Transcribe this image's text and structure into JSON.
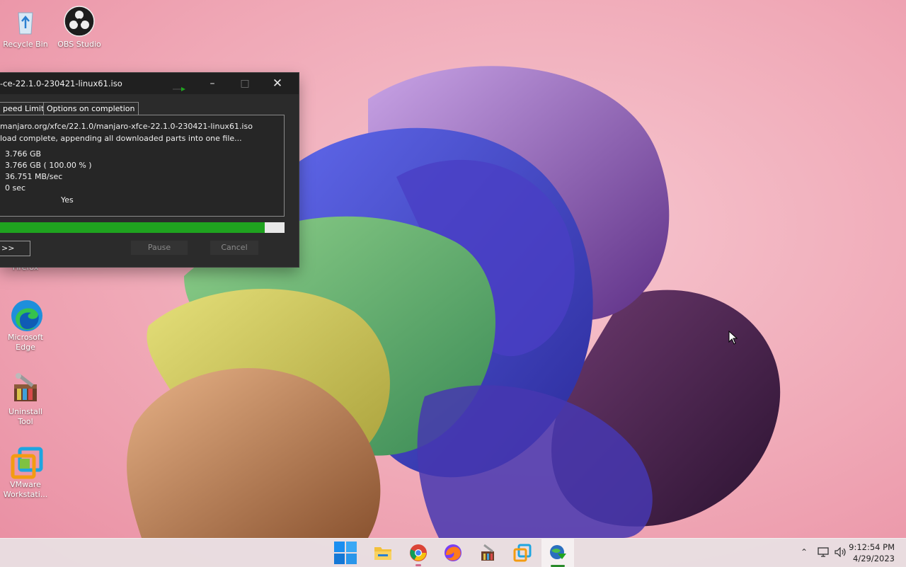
{
  "desktop": {
    "icons": [
      {
        "label": "Recycle Bin",
        "icon": "recycle-bin-icon"
      },
      {
        "label": "OBS Studio",
        "icon": "obs-studio-icon"
      },
      {
        "label": "Firefox",
        "icon": "firefox-icon"
      },
      {
        "label": "Microsoft Edge",
        "icon": "edge-icon"
      },
      {
        "label": "Uninstall Tool",
        "icon": "uninstall-tool-icon"
      },
      {
        "label": "VMware Workstati...",
        "icon": "vmware-icon"
      }
    ]
  },
  "idm_window": {
    "title": "-ce-22.1.0-230421-linux61.iso",
    "tabs": [
      "peed Limiter",
      "Options on completion"
    ],
    "url_line": "manjaro.org/xfce/22.1.0/manjaro-xfce-22.1.0-230421-linux61.iso",
    "status_line": "load complete, appending all downloaded parts into one file...",
    "file_size": "3.766  GB",
    "downloaded": "3.766  GB  ( 100.00 % )",
    "transfer_rate": "36.751  MB/sec",
    "time_left": "0 sec",
    "resume_capability": "Yes",
    "progress_percent": 93,
    "buttons": {
      "details": ">>",
      "pause": "Pause",
      "cancel": "Cancel"
    }
  },
  "taskbar": {
    "apps": [
      "start-icon",
      "file-explorer-icon",
      "chrome-icon",
      "firefox-icon",
      "uninstall-tool-icon",
      "vmware-icon",
      "idm-icon"
    ],
    "clock_time": "9:12:54 PM",
    "clock_date": "4/29/2023"
  }
}
